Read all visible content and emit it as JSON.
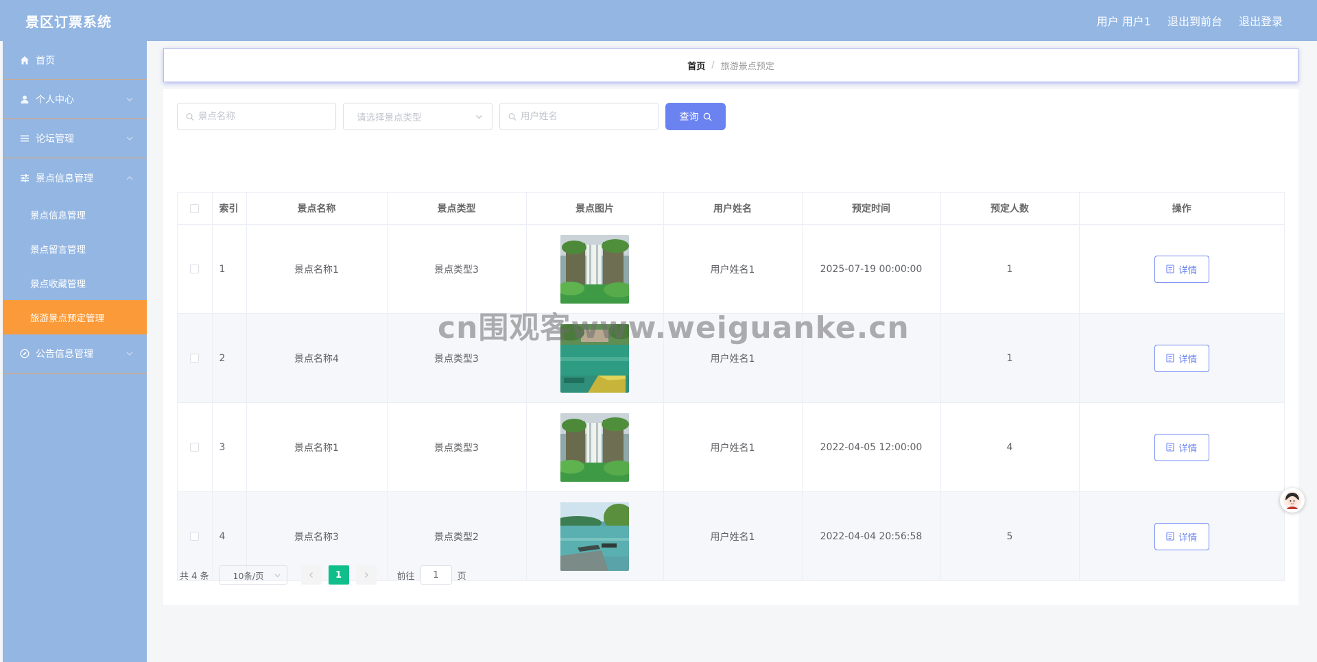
{
  "header": {
    "title": "景区订票系统",
    "user_label": "用户 用户1",
    "to_front_label": "退出到前台",
    "logout_label": "退出登录"
  },
  "sidebar": {
    "items": [
      {
        "label": "首页",
        "icon": "home-icon"
      },
      {
        "label": "个人中心",
        "icon": "user-icon"
      },
      {
        "label": "论坛管理",
        "icon": "list-icon"
      },
      {
        "label": "景点信息管理",
        "icon": "sliders-icon"
      }
    ],
    "subitems": [
      {
        "label": "景点信息管理"
      },
      {
        "label": "景点留言管理"
      },
      {
        "label": "景点收藏管理"
      },
      {
        "label": "旅游景点预定管理",
        "active": true
      }
    ],
    "after": [
      {
        "label": "公告信息管理",
        "icon": "compass-icon"
      }
    ]
  },
  "breadcrumb": {
    "home": "首页",
    "separator": "/",
    "current": "旅游景点预定"
  },
  "search": {
    "name_placeholder": "景点名称",
    "type_placeholder": "请选择景点类型",
    "user_placeholder": "用户姓名",
    "query_label": "查询"
  },
  "table": {
    "columns": [
      "索引",
      "景点名称",
      "景点类型",
      "景点图片",
      "用户姓名",
      "预定时间",
      "预定人数",
      "操作"
    ],
    "rows": [
      {
        "index": "1",
        "name": "景点名称1",
        "type": "景点类型3",
        "image": "waterfall",
        "user": "用户姓名1",
        "time": "2025-07-19 00:00:00",
        "count": "1",
        "action": "详情"
      },
      {
        "index": "2",
        "name": "景点名称4",
        "type": "景点类型3",
        "image": "lake",
        "user": "用户姓名1",
        "time": "",
        "count": "1",
        "action": "详情"
      },
      {
        "index": "3",
        "name": "景点名称1",
        "type": "景点类型3",
        "image": "waterfall",
        "user": "用户姓名1",
        "time": "2022-04-05 12:00:00",
        "count": "4",
        "action": "详情"
      },
      {
        "index": "4",
        "name": "景点名称3",
        "type": "景点类型2",
        "image": "pier",
        "user": "用户姓名1",
        "time": "2022-04-04 20:56:58",
        "count": "5",
        "action": "详情"
      }
    ]
  },
  "pagination": {
    "total_label": "共 4 条",
    "page_size": "10条/页",
    "current_page": "1",
    "goto_prefix": "前往",
    "goto_value": "1",
    "goto_suffix": "页"
  },
  "watermark": "cn围观客www.weiguanke.cn",
  "colors": {
    "header_bg": "#93b6e3",
    "sidebar_bg": "#93b6e3",
    "active_menu": "#fb9a38",
    "primary": "#6b83f1",
    "page_active": "#0fbe8a"
  }
}
